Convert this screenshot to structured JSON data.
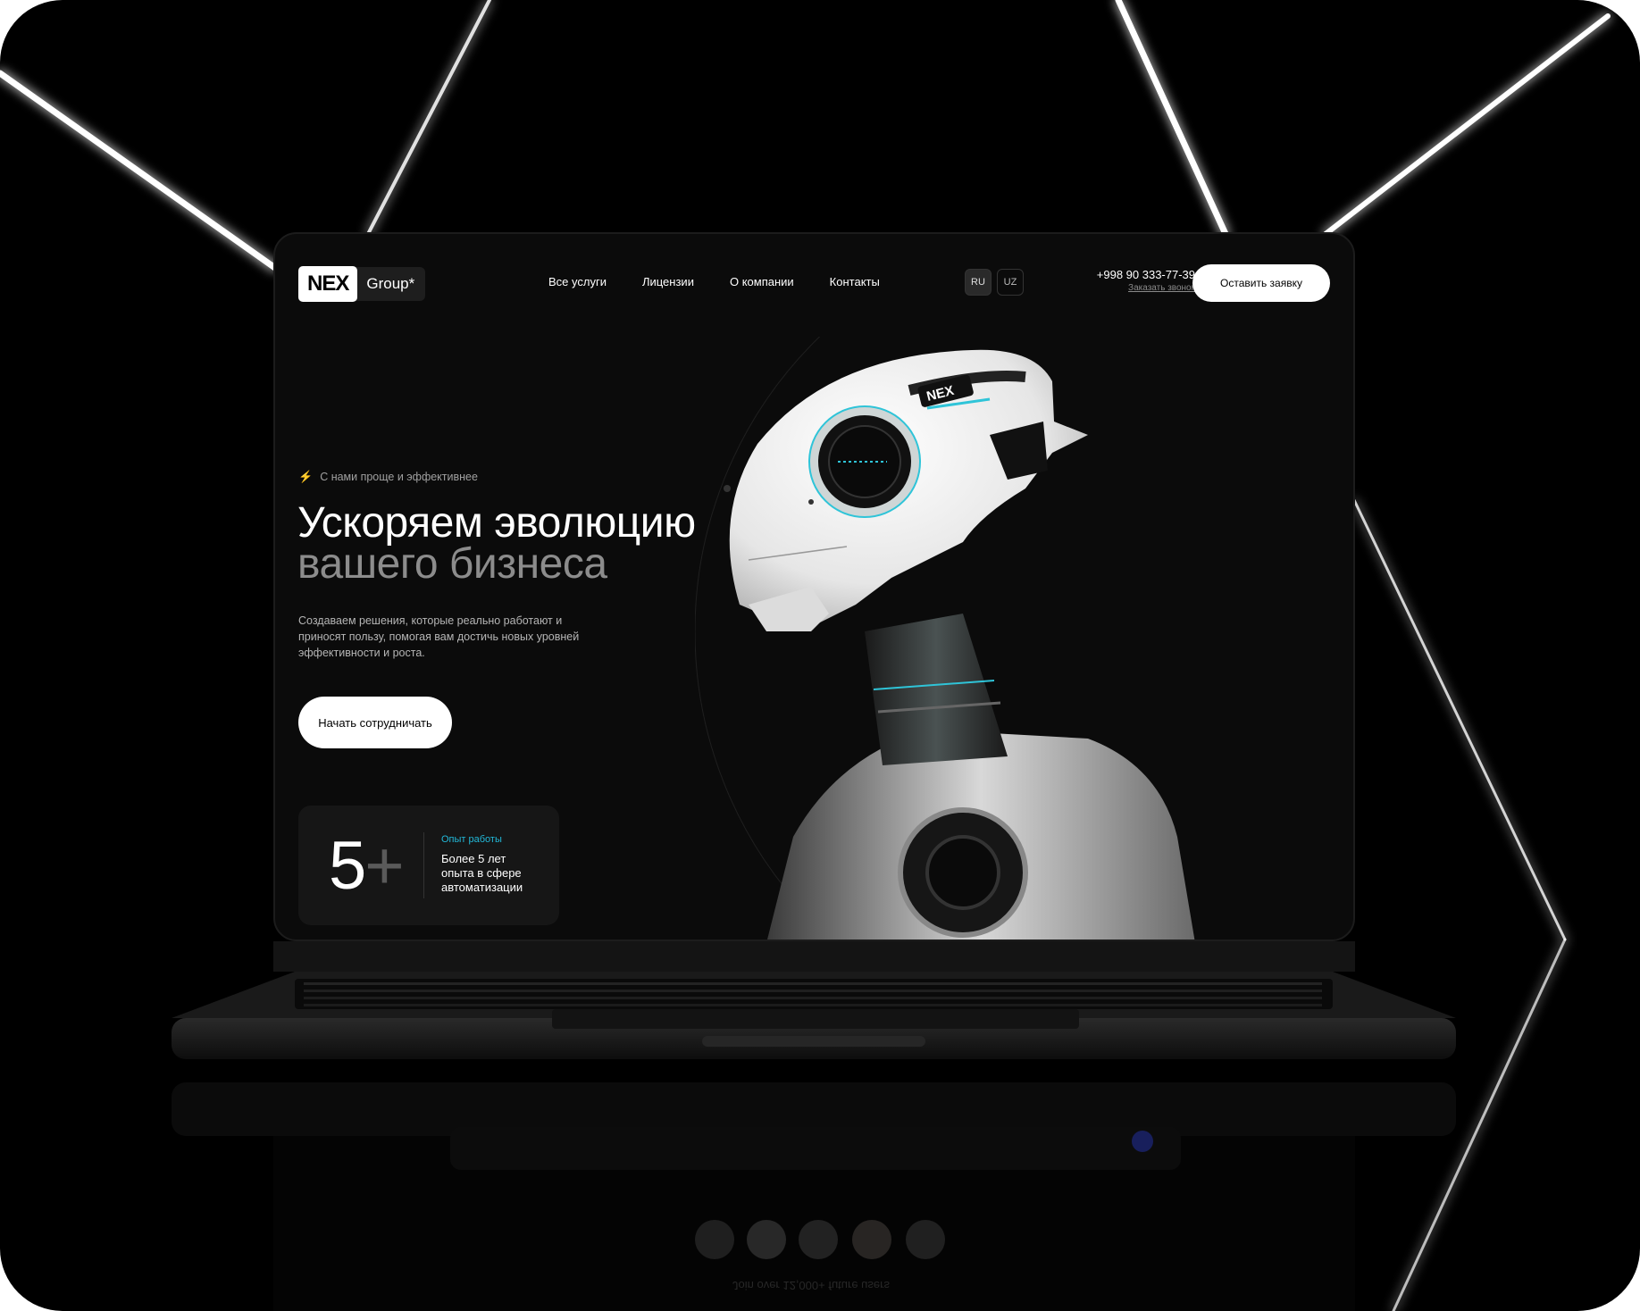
{
  "brand": {
    "mark": "NEX",
    "name": "Group*"
  },
  "nav": {
    "items": [
      "Все услуги",
      "Лицензии",
      "О компании",
      "Контакты"
    ]
  },
  "lang": {
    "options": [
      "RU",
      "UZ"
    ],
    "active": "RU"
  },
  "contact": {
    "phone": "+998 90 333-77-39",
    "callback": "Заказать звонок"
  },
  "header_cta": "Оставить заявку",
  "hero": {
    "tagline": "С нами проще и эффективнее",
    "title_line1": "Ускоряем эволюцию",
    "title_line2": "вашего бизнеса",
    "description": "Создаваем решения, которые реально работают и приносят пользу, помогая вам достичь новых уровней эффективности и роста.",
    "cta": "Начать сотрудничать"
  },
  "stat": {
    "value": "5",
    "suffix": "+",
    "label": "Опыт работы",
    "text": "Более 5 лет опыта в сфере автоматизации"
  },
  "robot_badge": "NEX",
  "reflection_caption": "Join over 12,000+ future users",
  "colors": {
    "accent": "#22c4dd",
    "background": "#0b0b0b",
    "button": "#ffffff"
  }
}
